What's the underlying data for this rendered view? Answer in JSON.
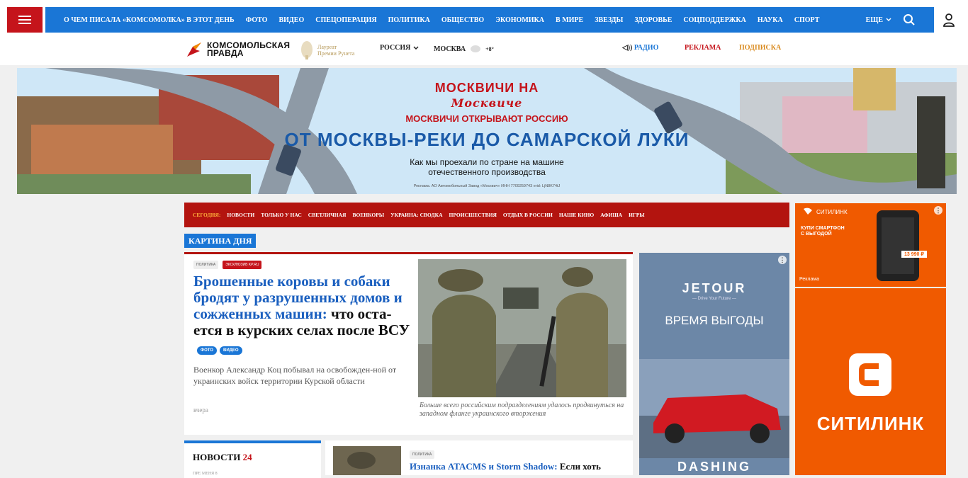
{
  "topnav": {
    "items": [
      "О ЧЕМ ПИСАЛА «КОМСОМОЛКА» В ЭТОТ ДЕНЬ",
      "ФОТО",
      "ВИДЕО",
      "СПЕЦОПЕРАЦИЯ",
      "ПОЛИТИКА",
      "ОБЩЕСТВО",
      "ЭКОНОМИКА",
      "В МИРЕ",
      "ЗВЕЗДЫ",
      "ЗДОРОВЬЕ",
      "СОЦПОДДЕРЖКА",
      "НАУКА",
      "СПОРТ"
    ],
    "more_label": "ЕЩЕ",
    "colors": {
      "nav_bg": "#1a76d6",
      "menu_bg": "#c5141b"
    }
  },
  "header": {
    "logo_line1": "КОМСОМОЛЬСКАЯ",
    "logo_line2": "ПРАВДА",
    "laureate_line1": "Лауреат",
    "laureate_line2": "Премии Рунета",
    "region": "РОССИЯ",
    "city": "МОСКВА",
    "temperature": "+8°",
    "radio": "РАДИО",
    "ads": "РЕКЛАМА",
    "subscription": "ПОДПИСКА"
  },
  "banner": {
    "logo_top": "МОСКВИЧИ НА",
    "logo_script": "Москвиче",
    "subtitle": "МОСКВИЧИ ОТКРЫВАЮТ РОССИЮ",
    "title": "ОТ МОСКВЫ-РЕКИ ДО САМАРСКОЙ ЛУКИ",
    "desc_line1": "Как мы проехали по стране на машине",
    "desc_line2": "отечественного производства",
    "legal": "Реклама. АО Автомобильный Завод «Москвич» ИНН 7709259743 erid: LjN8K74tJ"
  },
  "secnav": {
    "today": "СЕГОДНЯ:",
    "items": [
      "НОВОСТИ",
      "ТОЛЬКО У НАС",
      "СВЕТЛИЧНАЯ",
      "ВОЕНКОРЫ",
      "УКРАИНА: СВОДКА",
      "ПРОИСШЕСТВИЯ",
      "ОТДЫХ В РОССИИ",
      "НАШЕ КИНО",
      "АФИША",
      "ИГРЫ"
    ]
  },
  "main": {
    "section_label": "КАРТИНА ДНЯ",
    "tag1": "ПОЛИТИКА",
    "tag2": "ЭКСКЛЮЗИВ KP.RU",
    "headline_blue": "Брошенные коровы и собаки бродят у разрушенных домов и сожженных машин:",
    "headline_rest": " что оста-ется в курских селах после ВСУ",
    "pill1": "ФОТО",
    "pill2": "ВИДЕО",
    "lead": "Военкор Александр Коц побывал на освобожден-ной от украинских войск территории Курской области",
    "time": "вчера",
    "caption": "Больше всего российским подразделениям удалось продвинуться на западном фланге украинского вторжения"
  },
  "news24": {
    "title": "НОВОСТИ",
    "count": "24",
    "date": "ПРЕ МЕНЯ 8"
  },
  "bottom_card": {
    "tag": "ПОЛИТИКА",
    "title_blue": "Изнанка ATACMS и Storm Shadow:",
    "title_rest": " Если хоть"
  },
  "ads": {
    "jetour_brand": "JETOUR",
    "jetour_slogan": "— Drive Your Future —",
    "jetour_text": "ВРЕМЯ ВЫГОДЫ",
    "jetour_model": "DASHING",
    "citilink_brand": "СИТИЛИНК",
    "citilink_promo": "КУПИ СМАРТФОН С ВЫГОДОЙ",
    "citilink_price": "13 990 ₽",
    "citilink_ad": "Реклама",
    "citilink_word": "СИТИЛИНК"
  }
}
